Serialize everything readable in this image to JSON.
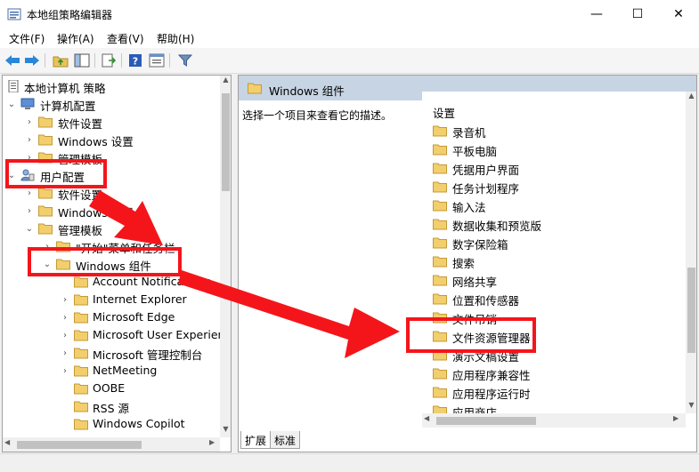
{
  "window": {
    "title": "本地组策略编辑器",
    "minimize": "—",
    "maximize": "☐",
    "close": "✕"
  },
  "menu": [
    "文件(F)",
    "操作(A)",
    "查看(V)",
    "帮助(H)"
  ],
  "toolbar_icons": [
    "back-arrow-icon",
    "forward-arrow-icon",
    "up-folder-icon",
    "show-hide-tree-icon",
    "export-list-icon",
    "help-icon",
    "properties-icon",
    "filter-icon"
  ],
  "tree": {
    "root": "本地计算机 策略",
    "computer_config": "计算机配置",
    "cc_software": "软件设置",
    "cc_windows": "Windows 设置",
    "cc_admin": "管理模板",
    "user_config": "用户配置",
    "uc_software": "软件设置",
    "uc_windows": "Windows 设置",
    "uc_admin": "管理模板",
    "start_menu": "\"开始\"菜单和任务栏",
    "win_components": "Windows 组件",
    "children": [
      "Account Notifications",
      "Internet Explorer",
      "Microsoft Edge",
      "Microsoft User Experien",
      "Microsoft 管理控制台",
      "NetMeeting",
      "OOBE",
      "RSS 源",
      "Windows Copilot"
    ]
  },
  "right": {
    "header": "Windows 组件",
    "description": "选择一个项目来查看它的描述。",
    "column": "设置",
    "items": [
      "录音机",
      "平板电脑",
      "凭据用户界面",
      "任务计划程序",
      "输入法",
      "数据收集和预览版",
      "数字保险箱",
      "搜索",
      "网络共享",
      "位置和传感器",
      "文件吊销",
      "文件资源管理器",
      "演示文稿设置",
      "应用程序兼容性",
      "应用程序运行时",
      "应用商店"
    ]
  },
  "tabs": [
    "扩展",
    "标准"
  ],
  "colors": {
    "highlight": "#f4151b",
    "header_band": "#c7d4e3",
    "folder": "#e8c25a"
  }
}
